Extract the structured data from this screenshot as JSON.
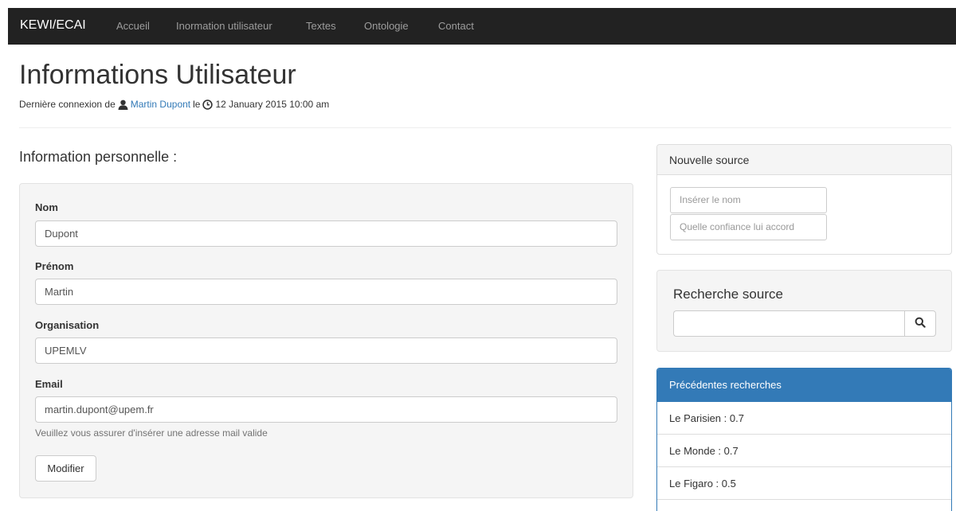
{
  "navbar": {
    "brand": "KEWI/ECAI",
    "links": [
      "Accueil",
      "Inormation utilisateur",
      "Textes",
      "Ontologie",
      "Contact"
    ]
  },
  "header": {
    "title": "Informations Utilisateur",
    "last_login_prefix": "Dernière connexion de",
    "user_name": "Martin Dupont",
    "last_login_mid": "le",
    "last_login_date": "12 January 2015 10:00 am"
  },
  "personal": {
    "section_title": "Information personnelle :",
    "fields": [
      {
        "label": "Nom",
        "value": "Dupont"
      },
      {
        "label": "Prénom",
        "value": "Martin"
      },
      {
        "label": "Organisation",
        "value": "UPEMLV"
      },
      {
        "label": "Email",
        "value": "martin.dupont@upem.fr"
      }
    ],
    "email_help": "Veuillez vous assurer d'insérer une adresse mail valide",
    "submit_label": "Modifier"
  },
  "new_source": {
    "heading": "Nouvelle source",
    "name_placeholder": "Insérer le nom",
    "confidence_placeholder": "Quelle confiance lui accord"
  },
  "search_source": {
    "title": "Recherche source",
    "query": "",
    "search_icon": "search-icon"
  },
  "previous_searches": {
    "heading": "Précédentes recherches",
    "items": [
      "Le Parisien : 0.7",
      "Le Monde : 0.7",
      "Le Figaro : 0.5"
    ]
  },
  "colors": {
    "navbar_bg": "#222222",
    "link": "#337ab7",
    "primary": "#337ab7"
  }
}
